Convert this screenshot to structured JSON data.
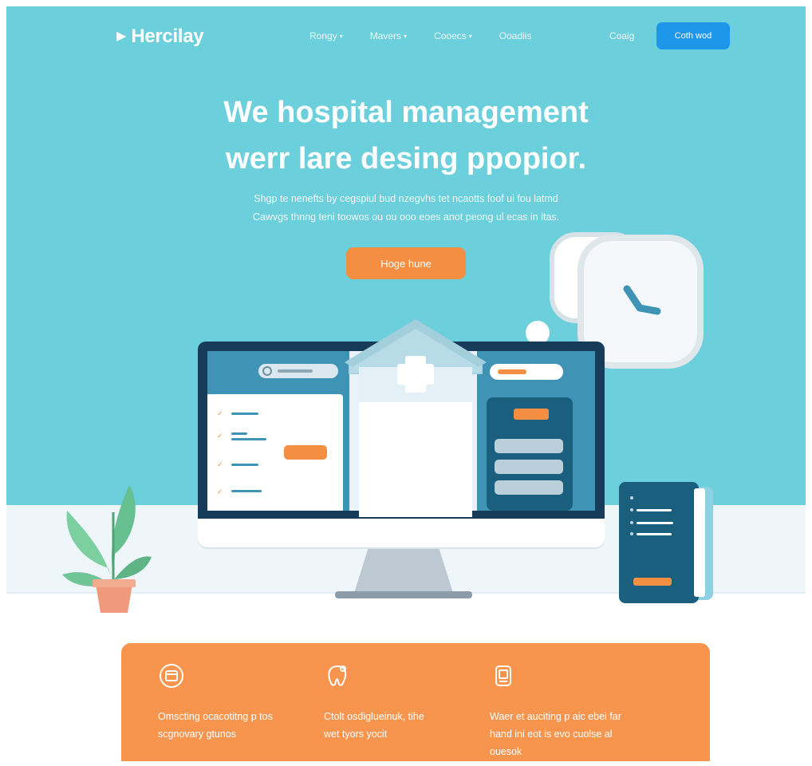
{
  "brand": {
    "name": "Hercilay",
    "logo_icon": "play-arrow-icon"
  },
  "nav": {
    "items": [
      {
        "label": "Rongy"
      },
      {
        "label": "Mavers"
      },
      {
        "label": "Cooecs"
      },
      {
        "label": "Ooadiis"
      }
    ],
    "login_label": "Coaig",
    "cta_label": "Coth wod"
  },
  "hero": {
    "headline_line1": "We hospital management",
    "headline_line2": "werr lare desing ppopior.",
    "subtext_line1": "Shgp te nenefts by cegspiul bud nzegvhs tet ncaotts foof ui fou latmd",
    "subtext_line2": "Cawvgs thnng teni toowos ou ou ooo eoes anot peong ul ecas in ltas.",
    "cta_label": "Hoge hune"
  },
  "features": [
    {
      "icon": "calendar-icon",
      "text_line1": "Omscting ocacotitng p tos",
      "text_line2": "scgnovary gtunos"
    },
    {
      "icon": "tooth-icon",
      "text_line1": "Ctolt osdiglueinuk, tihe",
      "text_line2": "wet tyors yocit"
    },
    {
      "icon": "clipboard-icon",
      "text_line1": "Waer et auciting p aic ebei far",
      "text_line2": "hand ini eot is evo cuolse al",
      "text_line3": "ouesok"
    }
  ],
  "colors": {
    "hero_bg": "#6ccfdc",
    "primary_blue": "#1e96ea",
    "accent_orange": "#f38e43",
    "feature_bg": "#f7954f",
    "dark_navy": "#173c5a"
  }
}
